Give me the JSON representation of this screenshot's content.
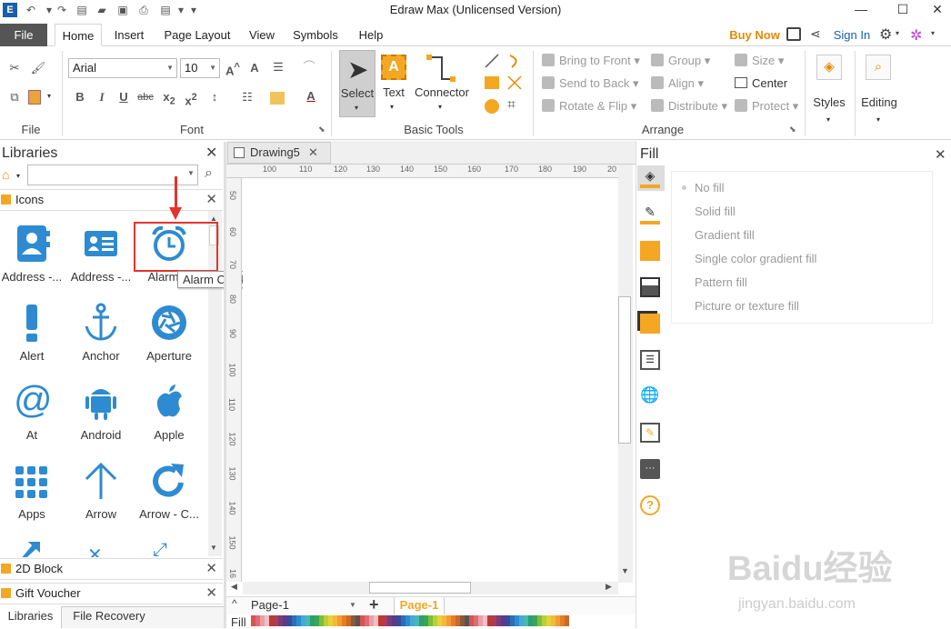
{
  "app": {
    "title": "Edraw Max (Unlicensed Version)"
  },
  "window_controls": {
    "minimize": "—",
    "maximize": "☐",
    "close": "✕"
  },
  "quick_access": [
    "app-logo-icon",
    "undo-icon",
    "redo-icon",
    "new-icon",
    "open-icon",
    "save-icon",
    "print-icon",
    "export-icon"
  ],
  "menu": {
    "file": "File",
    "tabs": [
      "Home",
      "Insert",
      "Page Layout",
      "View",
      "Symbols",
      "Help"
    ],
    "buy_now": "Buy Now",
    "sign_in": "Sign In"
  },
  "ribbon": {
    "file_group": {
      "label": "File"
    },
    "font_group": {
      "label": "Font",
      "font_name": "Arial",
      "font_size": "10"
    },
    "basic_tools": {
      "label": "Basic Tools",
      "select": "Select",
      "text": "Text",
      "connector": "Connector"
    },
    "arrange": {
      "label": "Arrange",
      "bring_to_front": "Bring to Front",
      "send_to_back": "Send to Back",
      "rotate_flip": "Rotate & Flip",
      "group": "Group",
      "align": "Align",
      "distribute": "Distribute",
      "size": "Size",
      "center": "Center",
      "protect": "Protect"
    },
    "styles": "Styles",
    "editing": "Editing"
  },
  "libraries": {
    "title": "Libraries",
    "search_placeholder": "",
    "section_icons": "Icons",
    "icons": [
      {
        "label": "Address -...",
        "icon": "address-book-icon"
      },
      {
        "label": "Address -...",
        "icon": "address-card-icon"
      },
      {
        "label": "Alarm C",
        "icon": "alarm-clock-icon"
      },
      {
        "label": "Alert",
        "icon": "alert-icon"
      },
      {
        "label": "Anchor",
        "icon": "anchor-icon"
      },
      {
        "label": "Aperture",
        "icon": "aperture-icon"
      },
      {
        "label": "At",
        "icon": "at-icon"
      },
      {
        "label": "Android",
        "icon": "android-icon"
      },
      {
        "label": "Apple",
        "icon": "apple-icon"
      },
      {
        "label": "Apps",
        "icon": "apps-icon"
      },
      {
        "label": "Arrow",
        "icon": "arrow-icon"
      },
      {
        "label": "Arrow - C...",
        "icon": "arrow-circle-icon"
      }
    ],
    "tooltip": "Alarm Clock",
    "section_2d_block": "2D Block",
    "section_gift_voucher": "Gift Voucher",
    "bottom_tabs": [
      "Libraries",
      "File Recovery"
    ]
  },
  "document": {
    "tab": "Drawing5",
    "h_ruler": [
      "100",
      "110",
      "120",
      "130",
      "140",
      "150",
      "160",
      "170",
      "180",
      "190",
      "20"
    ],
    "v_ruler": [
      "50",
      "60",
      "70",
      "80",
      "90",
      "100",
      "110",
      "120",
      "130",
      "140",
      "150",
      "16"
    ],
    "page_select": "Page-1",
    "page_tab": "Page-1",
    "fill_label": "Fill"
  },
  "fill_panel": {
    "title": "Fill",
    "options": [
      "No fill",
      "Solid fill",
      "Gradient fill",
      "Single color gradient fill",
      "Pattern fill",
      "Picture or texture fill"
    ]
  },
  "colors": {
    "accent": "#f5a623",
    "icon_blue": "#2e8bd1",
    "highlight_red": "#e5322d",
    "file_tab": "#555555"
  },
  "watermark": {
    "text": "Baidu经验",
    "url": "jingyan.baidu.com"
  }
}
